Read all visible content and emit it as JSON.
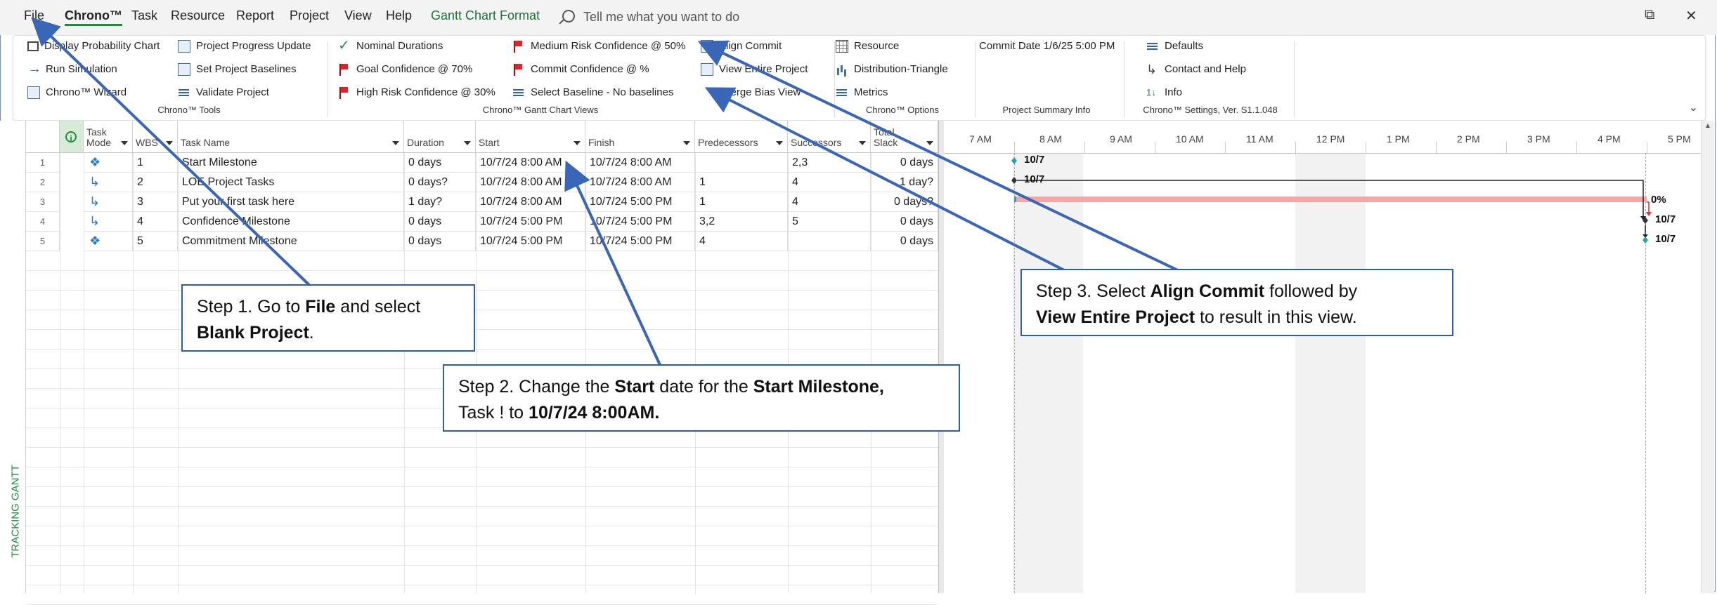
{
  "menu": {
    "items": [
      "File",
      "Chrono™",
      "Task",
      "Resource",
      "Report",
      "Project",
      "View",
      "Help",
      "Gantt Chart Format"
    ],
    "search_placeholder": "Tell me what you want to do"
  },
  "ribbon": {
    "col1": [
      "Display Probability Chart",
      "Run Simulation",
      "Chrono™ Wizard"
    ],
    "col2": [
      "Project Progress Update",
      "Set Project Baselines",
      "Validate Project"
    ],
    "group_tools": "Chrono™ Tools",
    "col3": [
      "Nominal Durations",
      "Goal Confidence @ 70%",
      "High Risk Confidence @ 30%"
    ],
    "col4": [
      "Medium Risk Confidence @ 50%",
      "Commit Confidence @ %",
      "Select Baseline - No baselines"
    ],
    "col5": [
      "Align Commit",
      "View Entire Project",
      "Merge Bias View"
    ],
    "group_views": "Chrono™ Gantt Chart Views",
    "col6": [
      "Resource",
      "Distribution-Triangle",
      "Metrics"
    ],
    "group_options": "Chrono™ Options",
    "commit_date": "Commit Date 1/6/25 5:00 PM",
    "group_summary": "Project Summary Info",
    "col8": [
      "Defaults",
      "Contact and Help",
      "Info"
    ],
    "group_settings": "Chrono™ Settings, Ver. S1.1.048"
  },
  "table": {
    "headers": {
      "task_mode": "Task Mode",
      "wbs": "WBS",
      "task_name": "Task Name",
      "duration": "Duration",
      "start": "Start",
      "finish": "Finish",
      "predecessors": "Predecessors",
      "successors": "Successors",
      "total_slack": "Total Slack"
    },
    "rows": [
      {
        "num": "1",
        "wbs": "1",
        "name": "Start Milestone",
        "duration": "0 days",
        "start": "10/7/24 8:00 AM",
        "finish": "10/7/24 8:00 AM",
        "pred": "",
        "succ": "2,3",
        "slack": "0 days"
      },
      {
        "num": "2",
        "wbs": "2",
        "name": "LOE Project Tasks",
        "duration": "0 days?",
        "start": "10/7/24 8:00 AM",
        "finish": "10/7/24 8:00 AM",
        "pred": "1",
        "succ": "4",
        "slack": "1 day?"
      },
      {
        "num": "3",
        "wbs": "3",
        "name": "Put your first task here",
        "duration": "1 day?",
        "start": "10/7/24 8:00 AM",
        "finish": "10/7/24 5:00 PM",
        "pred": "1",
        "succ": "4",
        "slack": "0 days?"
      },
      {
        "num": "4",
        "wbs": "4",
        "name": "Confidence Milestone",
        "duration": "0 days",
        "start": "10/7/24 5:00 PM",
        "finish": "10/7/24 5:00 PM",
        "pred": "3,2",
        "succ": "5",
        "slack": "0 days"
      },
      {
        "num": "5",
        "wbs": "5",
        "name": "Commitment Milestone",
        "duration": "0 days",
        "start": "10/7/24 5:00 PM",
        "finish": "10/7/24 5:00 PM",
        "pred": "4",
        "succ": "",
        "slack": "0 days"
      }
    ],
    "side_label": "TRACKING GANTT"
  },
  "gantt": {
    "time_ticks": [
      "7 AM",
      "8 AM",
      "9 AM",
      "10 AM",
      "11 AM",
      "12 PM",
      "1 PM",
      "2 PM",
      "3 PM",
      "4 PM",
      "5 PM"
    ],
    "labels": {
      "row1": "10/7",
      "row2": "10/7",
      "row3": "0%",
      "row4": "10/7",
      "row5": "10/7"
    }
  },
  "callouts": {
    "step1": {
      "pre": "Step 1. Go to ",
      "b1": "File",
      "mid": " and select ",
      "b2": "Blank Project",
      "post": "."
    },
    "step2": {
      "pre": "Step 2. Change the ",
      "b1": "Start",
      "mid": " date for the ",
      "b2": "Start Milestone,",
      "line2a": "Task ! to ",
      "b3": "10/7/24 8:00AM."
    },
    "step3": {
      "pre": "Step 3. Select ",
      "b1": "Align Commit",
      "mid": " followed by",
      "b2": "View Entire Project",
      "post": " to result in this view."
    }
  },
  "colors": {
    "accent": "#1e8a3e",
    "callout_border": "#2f5ea8",
    "task_bar": "#f4a7a7"
  }
}
